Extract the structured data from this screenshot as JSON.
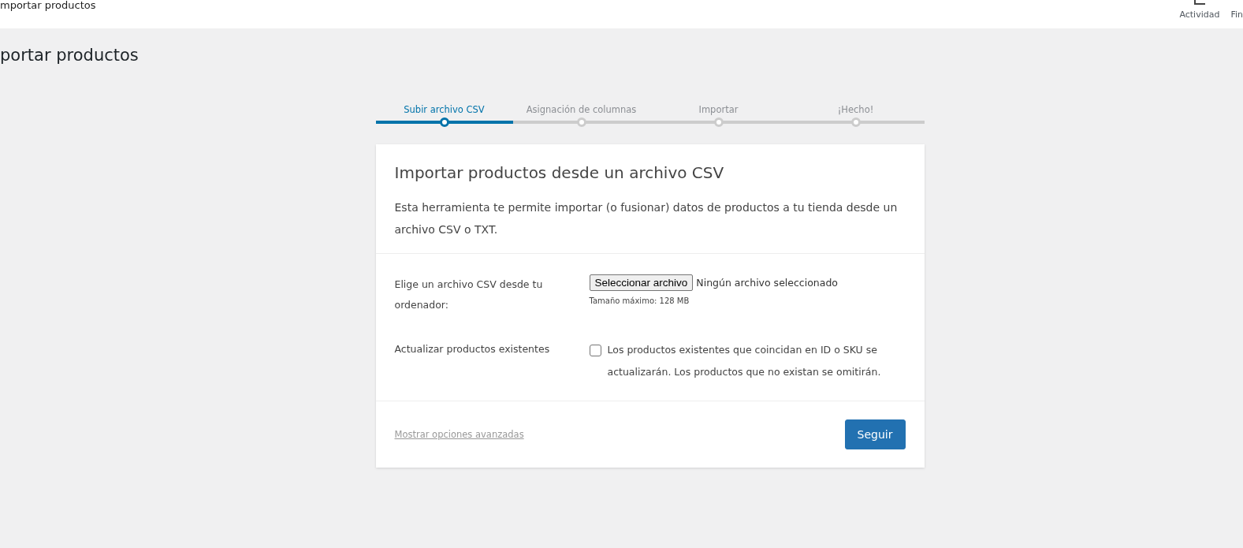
{
  "header": {
    "title": "mportar productos",
    "actions": [
      {
        "label": "Actividad"
      },
      {
        "label": "Fin"
      }
    ]
  },
  "page_title": "portar productos",
  "steps": [
    {
      "label": "Subir archivo CSV",
      "selected": true
    },
    {
      "label": "Asignación de columnas",
      "selected": false
    },
    {
      "label": "Importar",
      "selected": false
    },
    {
      "label": "¡Hecho!",
      "selected": false
    }
  ],
  "card": {
    "title": "Importar productos desde un archivo CSV",
    "description": "Esta herramienta te permite importar (o fusionar) datos de productos a tu tienda desde un archivo CSV o TXT.",
    "file_field": {
      "label": "Elige un archivo CSV desde tu ordenador:",
      "button": "Seleccionar archivo",
      "status": "Ningún archivo seleccionado",
      "hint": "Tamaño máximo: 128 MB"
    },
    "update_field": {
      "label": "Actualizar productos existentes",
      "checked": false,
      "text": "Los productos existentes que coincidan en ID o SKU se actualizarán. Los productos que no existan se omitirán."
    },
    "advanced_link": "Mostrar opciones avanzadas",
    "submit": "Seguir"
  }
}
